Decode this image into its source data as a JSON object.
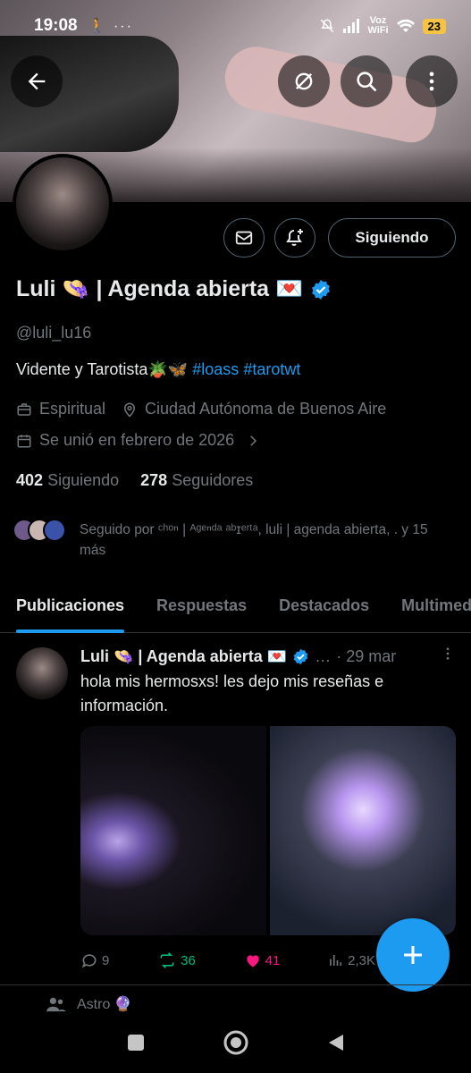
{
  "status_bar": {
    "time": "19:08",
    "left_icons": "🚶 ···",
    "network_label_1": "Voz",
    "network_label_2": "WiFi",
    "battery": "23"
  },
  "banner": {
    "back_icon": "arrow-left-icon",
    "sync_icon": "sync-off-icon",
    "search_icon": "search-icon",
    "more_icon": "more-vertical-icon"
  },
  "profile": {
    "name": "Luli 👒 | Agenda abierta 💌",
    "verified": true,
    "handle": "@luli_lu16",
    "bio_text": "Vidente y Tarotista🪴🦋 ",
    "bio_tags": [
      "#loass",
      "#tarotwt"
    ],
    "category": "Espiritual",
    "location": "Ciudad Autónoma de Buenos Aire",
    "joined": "Se unió en febrero de 2026",
    "following_count": "402",
    "following_label": "Siguiendo",
    "followers_count": "278",
    "followers_label": "Seguidores",
    "followed_by_text": "Seguido por ᶜʰᵒⁿ | ᴬᵍᵉⁿᵈᵃ ᵃᵇɪᵉʳᵗᵃ, luli | agenda abierta, . y 15 más",
    "follow_button_label": "Siguiendo"
  },
  "tabs": [
    "Publicaciones",
    "Respuestas",
    "Destacados",
    "Multimedia"
  ],
  "post": {
    "author": "Luli 👒 | Agenda abierta 💌",
    "ellipsis": "…",
    "date": "· 29 mar",
    "text": "hola mis hermosxs! les dejo mis reseñas e información.",
    "replies": "9",
    "reposts": "36",
    "likes": "41",
    "views": "2,3K"
  },
  "next_item": {
    "label": "Astro 🔮"
  },
  "colors": {
    "accent": "#1d9bf0",
    "repost": "#00ba7c",
    "like": "#f91880",
    "muted": "#71767b"
  }
}
